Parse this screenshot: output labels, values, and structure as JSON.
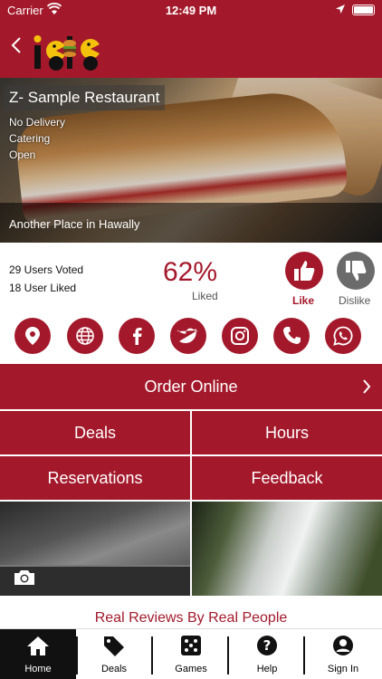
{
  "status_bar": {
    "carrier": "Carrier",
    "time": "12:49 PM"
  },
  "restaurant": {
    "name": "Z- Sample Restaurant",
    "info": [
      "No Delivery",
      "Catering",
      "Open"
    ],
    "location": "Another Place in Hawally"
  },
  "rating": {
    "votes_text": "29 Users Voted",
    "liked_text": "18 User Liked",
    "percent": "62%",
    "percent_label": "Liked",
    "like_label": "Like",
    "dislike_label": "Dislike"
  },
  "social_icons": [
    "location-icon",
    "web-icon",
    "facebook-icon",
    "twitter-icon",
    "instagram-icon",
    "phone-icon",
    "whatsapp-icon"
  ],
  "actions": {
    "order_online": "Order Online",
    "deals": "Deals",
    "hours": "Hours",
    "reservations": "Reservations",
    "feedback": "Feedback"
  },
  "reviews_heading": "Real Reviews By Real People",
  "tabs": [
    {
      "label": "Home",
      "icon": "home-icon",
      "active": true
    },
    {
      "label": "Deals",
      "icon": "tag-icon",
      "active": false
    },
    {
      "label": "Games",
      "icon": "dice-icon",
      "active": false
    },
    {
      "label": "Help",
      "icon": "help-icon",
      "active": false
    },
    {
      "label": "Sign In",
      "icon": "user-icon",
      "active": false
    }
  ],
  "colors": {
    "brand": "#a3192b",
    "dislike": "#6b6b6b"
  }
}
